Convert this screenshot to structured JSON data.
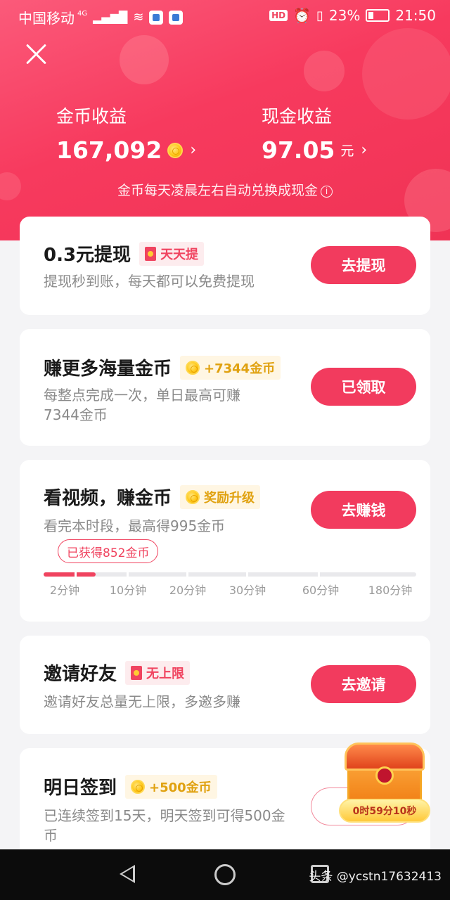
{
  "status_bar": {
    "carrier": "中国移动",
    "network": "4G",
    "hd": "HD",
    "battery": "23%",
    "time": "21:50"
  },
  "header": {
    "coin_label": "金币收益",
    "coin_value": "167,092",
    "cash_label": "现金收益",
    "cash_value": "97.05",
    "cash_unit": "元",
    "note": "金币每天凌晨左右自动兑换成现金",
    "chevron": "›",
    "info": "i"
  },
  "cards": [
    {
      "title": "0.3元提现",
      "badge": "天天提",
      "desc": "提现秒到账，每天都可以免费提现",
      "button": "去提现"
    },
    {
      "title": "赚更多海量金币",
      "badge": "+7344金币",
      "desc": "每整点完成一次，单日最高可赚7344金币",
      "button": "已领取"
    },
    {
      "title": "看视频，赚金币",
      "badge": "奖励升级",
      "desc": "看完本时段，最高得995金币",
      "button": "去赚钱",
      "progress": {
        "tip": "已获得852金币",
        "filled_fraction": 0.14,
        "labels": [
          "2分钟",
          "10分钟",
          "20分钟",
          "30分钟",
          "60分钟",
          "180分钟"
        ]
      }
    },
    {
      "title": "邀请好友",
      "badge": "无上限",
      "desc": "邀请好友总量无上限，多邀多赚",
      "button": "去邀请"
    },
    {
      "title": "明日签到",
      "badge": "+500金币",
      "desc": "已连续签到15天，明天签到可得500金币",
      "button": ""
    }
  ],
  "chest": {
    "timer": "0时59分10秒"
  },
  "watermark": "头条 @ycstn17632413",
  "colors": {
    "accent": "#f23b5e",
    "gold": "#e0a10f"
  }
}
